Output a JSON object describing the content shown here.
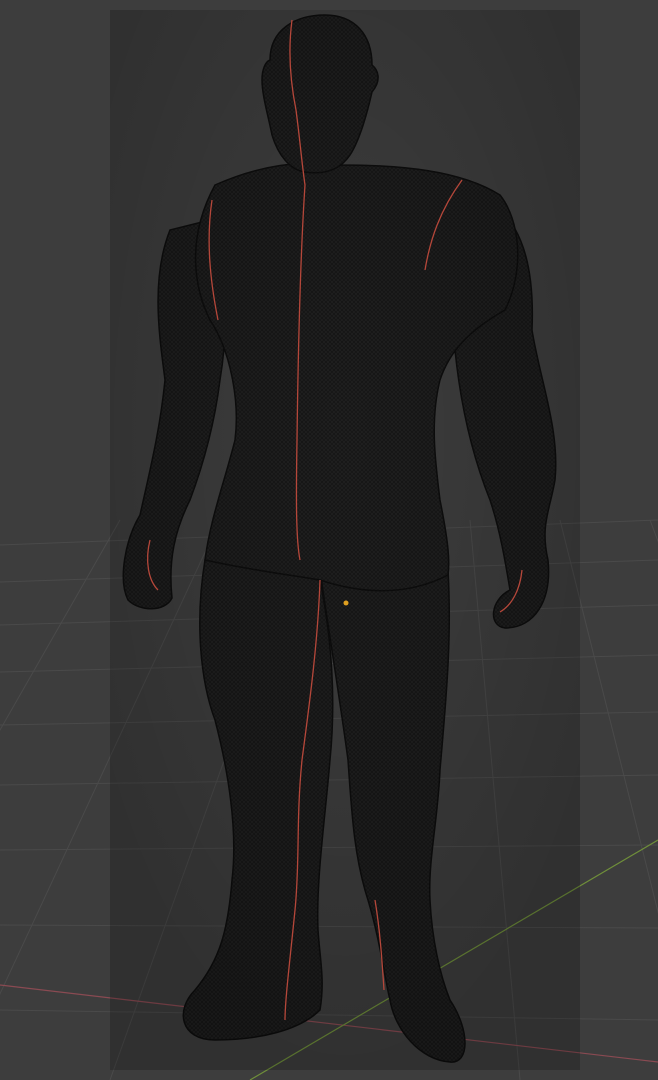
{
  "viewport": {
    "mode": "3d-viewport",
    "shading": "wireframe-overlay-on-solid",
    "background_color": "#3d3d3d",
    "grid_color": "#4a4a4a",
    "x_axis_color": "#8a4a52",
    "y_axis_color": "#6f8f3a",
    "mesh_color": "#1e1e1e",
    "wire_color": "#0d0d0d",
    "seam_color": "#b5473a",
    "origin_color": "#e0a020",
    "object": {
      "type": "mesh",
      "subject": "orc-character-model",
      "selected": false,
      "uv_seams_visible": true
    }
  }
}
